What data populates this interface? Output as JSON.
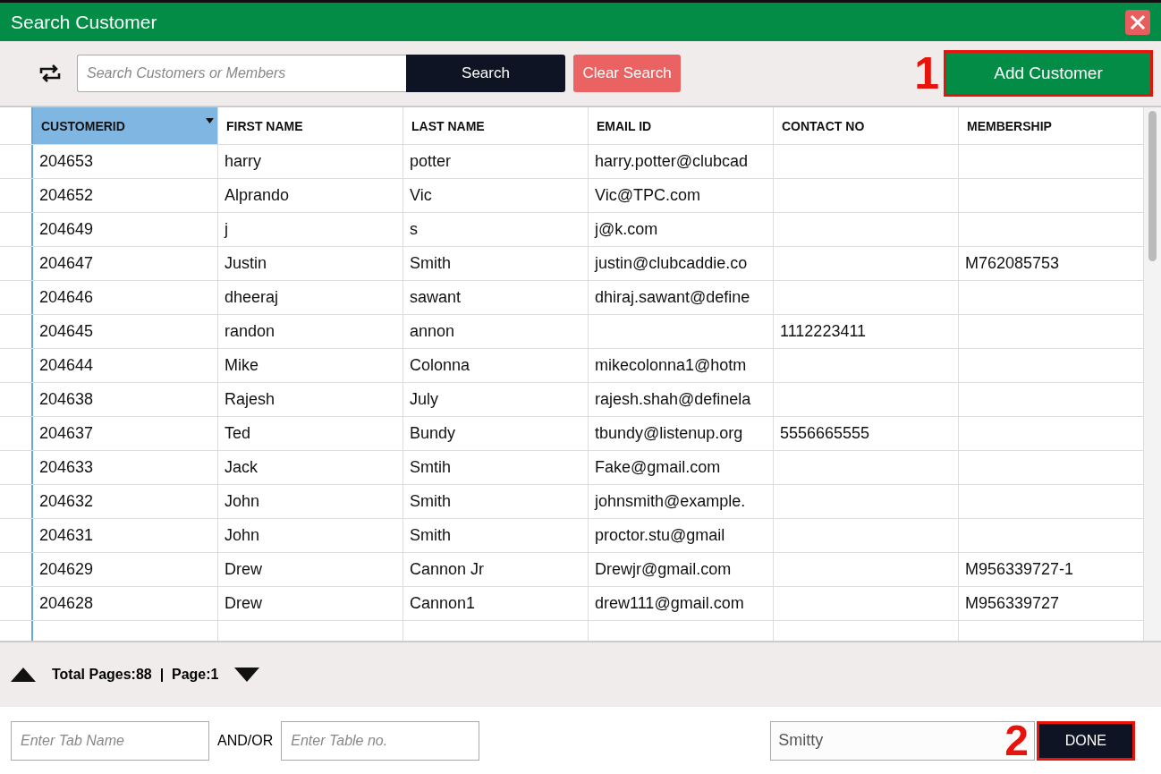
{
  "window": {
    "title": "Search Customer"
  },
  "toolbar": {
    "search": {
      "placeholder": "Search Customers or Members"
    },
    "search_button": "Search",
    "clear_button": "Clear Search",
    "add_button": {
      "label": "Add Customer",
      "highlighted": true,
      "callout": "1"
    }
  },
  "table": {
    "columns": [
      {
        "label": "CUSTOMERID",
        "sorted": true
      },
      {
        "label": "FIRST NAME",
        "sorted": false
      },
      {
        "label": "LAST NAME",
        "sorted": false
      },
      {
        "label": "EMAIL ID",
        "sorted": false
      },
      {
        "label": "CONTACT NO",
        "sorted": false
      },
      {
        "label": "MEMBERSHIP",
        "sorted": false
      }
    ],
    "rows": [
      [
        "204653",
        "harry",
        "potter",
        "harry.potter@clubcad",
        "",
        ""
      ],
      [
        "204652",
        "Alprando",
        "Vic",
        "Vic@TPC.com",
        "",
        ""
      ],
      [
        "204649",
        "j",
        "s",
        "j@k.com",
        "",
        ""
      ],
      [
        "204647",
        "Justin",
        "Smith",
        "justin@clubcaddie.co",
        "",
        "M762085753"
      ],
      [
        "204646",
        "dheeraj",
        "sawant",
        "dhiraj.sawant@define",
        "",
        ""
      ],
      [
        "204645",
        "randon",
        "annon",
        "",
        "1112223411",
        ""
      ],
      [
        "204644",
        "Mike",
        "Colonna",
        "mikecolonna1@hotm",
        "",
        ""
      ],
      [
        "204638",
        "Rajesh",
        "July",
        "rajesh.shah@definela",
        "",
        ""
      ],
      [
        "204637",
        "Ted",
        "Bundy",
        "tbundy@listenup.org",
        "5556665555",
        ""
      ],
      [
        "204633",
        "Jack",
        "Smtih",
        "Fake@gmail.com",
        "",
        ""
      ],
      [
        "204632",
        "John",
        "Smith",
        "johnsmith@example.",
        "",
        ""
      ],
      [
        "204631",
        "John",
        "Smith",
        "proctor.stu@gmail",
        "",
        ""
      ],
      [
        "204629",
        "Drew",
        "Cannon Jr",
        "Drewjr@gmail.com",
        "",
        "M956339727-1"
      ],
      [
        "204628",
        "Drew",
        "Cannon1",
        "drew111@gmail.com",
        "",
        "M956339727"
      ]
    ]
  },
  "pager": {
    "text": "Total Pages:88  |  Page:1"
  },
  "footer": {
    "tab_field": {
      "placeholder": "Enter Tab Name"
    },
    "joiner": "AND/OR",
    "table_field": {
      "placeholder": "Enter Table no."
    },
    "server_select": {
      "value": "Smitty"
    },
    "done_button": {
      "label": "DONE",
      "highlighted": true,
      "callout": "2"
    }
  }
}
